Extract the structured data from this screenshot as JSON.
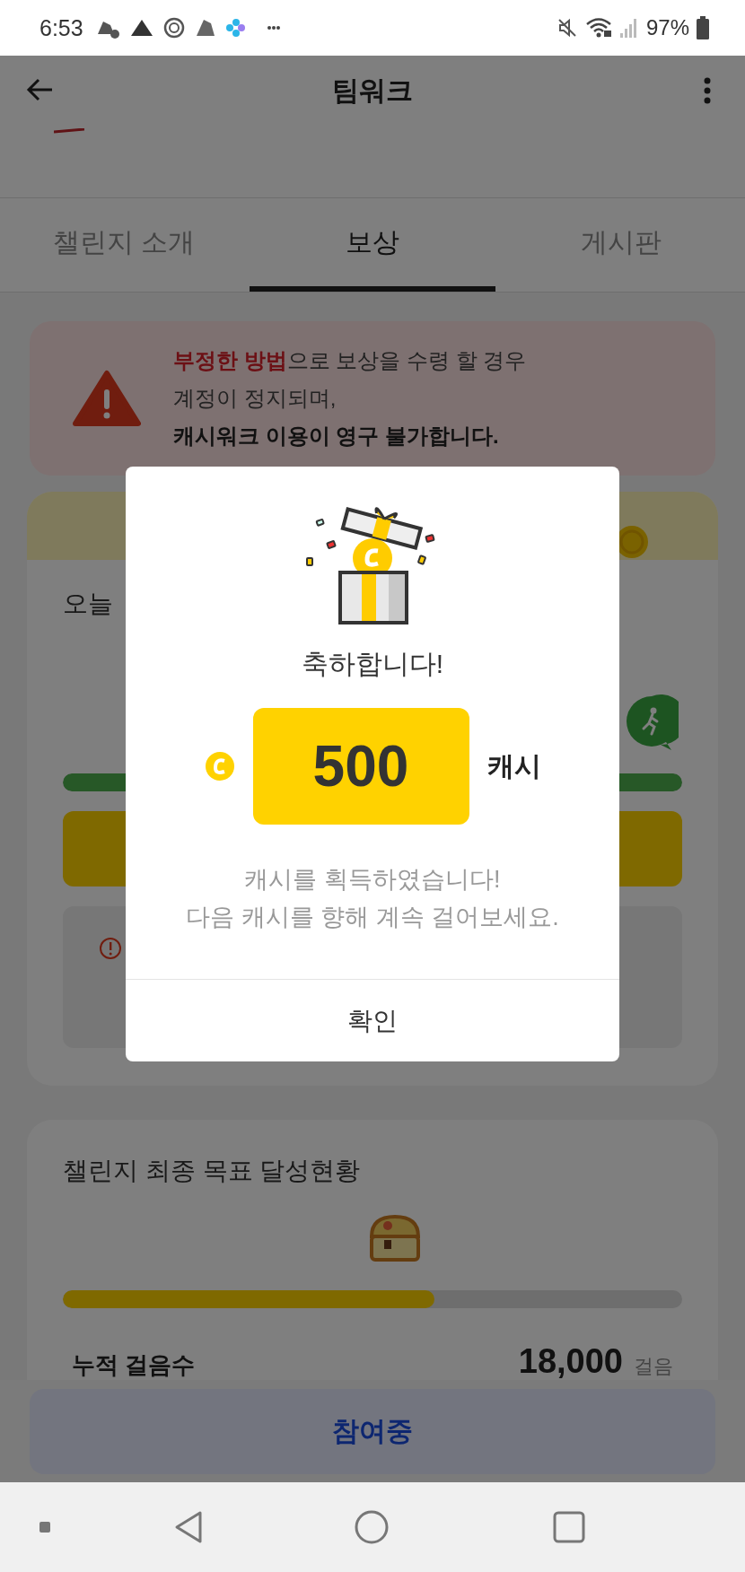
{
  "status_bar": {
    "time": "6:53",
    "battery": "97%"
  },
  "header": {
    "title": "팀워크"
  },
  "tabs": [
    {
      "label": "챌린지 소개",
      "selected": false
    },
    {
      "label": "보상",
      "selected": true
    },
    {
      "label": "게시판",
      "selected": false
    }
  ],
  "warning": {
    "highlight": "부정한 방법",
    "text": "으로 보상을 수령 할 경우",
    "line_2": "계정이 정지되며,",
    "line_3": "캐시워크 이용이 영구 불가합니다."
  },
  "daily_card": {
    "title": "오늘",
    "progress": {
      "level": 1
    }
  },
  "final_card": {
    "title": "챌린지 최종 목표 달성현황",
    "progress": {
      "level": 0.6
    },
    "label": "누적 걸음수",
    "value": "18,000",
    "unit": "걸음"
  },
  "bottom_button": "참여중",
  "dialog": {
    "title": "축하합니다!",
    "amount": "500",
    "unit": "캐시",
    "message": [
      "캐시를 획득하였습니다!",
      "다음 캐시를 향해 계속 걸어보세요."
    ],
    "confirm": "확인"
  }
}
